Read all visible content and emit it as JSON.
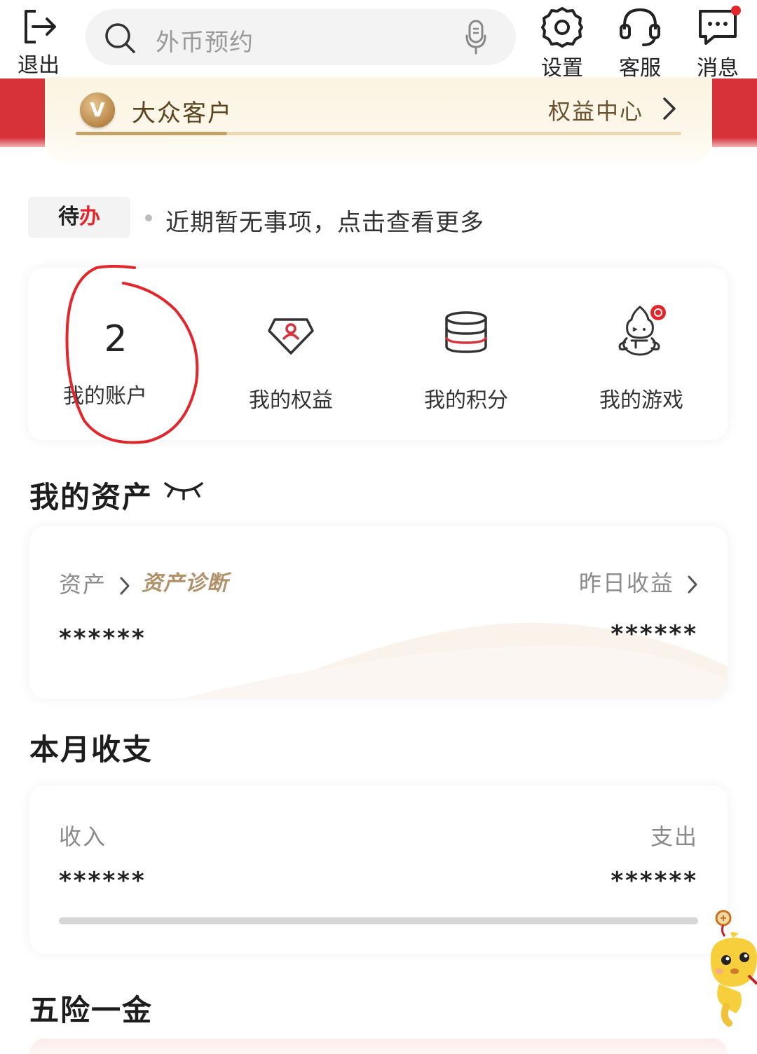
{
  "topbar": {
    "exit_label": "退出",
    "search_placeholder": "外币预约",
    "settings_label": "设置",
    "service_label": "客服",
    "messages_label": "消息",
    "has_unread_messages": true
  },
  "member": {
    "badge_letter": "V",
    "tier": "大众客户",
    "benefits_center": "权益中心",
    "progress": 0.25
  },
  "todo": {
    "tag_prefix": "待",
    "tag_suffix": "办",
    "text": "近期暂无事项，点击查看更多"
  },
  "quick": {
    "account_count": "2",
    "account_label": "我的账户",
    "equity_label": "我的权益",
    "points_label": "我的积分",
    "games_label": "我的游戏"
  },
  "assets": {
    "title": "我的资产",
    "eye_icon": "eye-closed-icon",
    "assets_label": "资产",
    "diagnosis_label": "资产诊断",
    "yesterday_label": "昨日收益",
    "assets_value": "******",
    "yesterday_value": "******"
  },
  "monthly": {
    "title": "本月收支",
    "income_label": "收入",
    "expense_label": "支出",
    "income_value": "******",
    "expense_value": "******",
    "ratio": 1.0
  },
  "insurance": {
    "title": "五险一金"
  },
  "colors": {
    "brand_red": "#d7313a",
    "gold": "#c5a26c",
    "annotation_red": "#e3262b"
  }
}
